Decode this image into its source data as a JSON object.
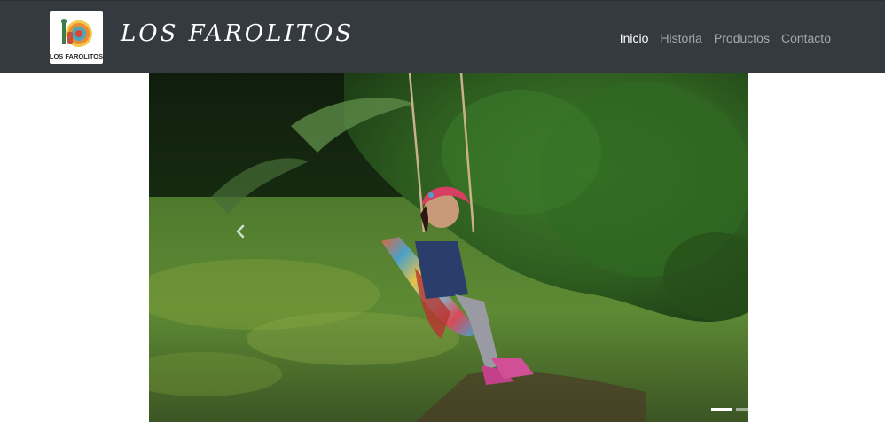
{
  "navbar": {
    "logo": {
      "text": "LOS FAROLITOS",
      "icon": "farolitos-logo-icon"
    },
    "brand": "LOS FAROLITOS",
    "links": [
      {
        "label": "Inicio",
        "active": true
      },
      {
        "label": "Historia",
        "active": false
      },
      {
        "label": "Productos",
        "active": false
      },
      {
        "label": "Contacto",
        "active": false
      }
    ],
    "colors": {
      "background": "#343a40",
      "link": "#ffffffb3",
      "link_active": "#ffffff"
    }
  },
  "carousel": {
    "slide_image": "child-on-colorful-swing-in-garden",
    "prev_icon": "chevron-left-icon",
    "indicators": {
      "count": 2,
      "active": 0
    }
  }
}
